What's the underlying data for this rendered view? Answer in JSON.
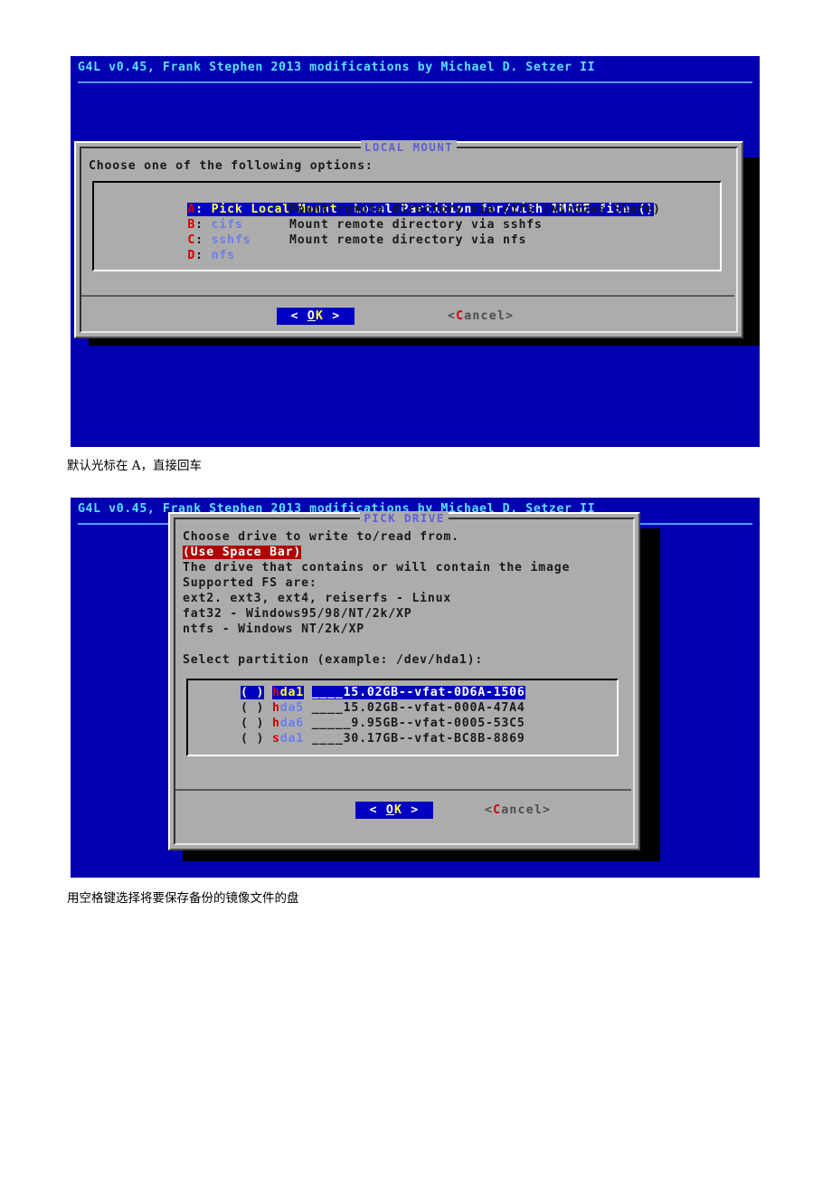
{
  "document": {
    "captions": [
      {
        "id": "caption-1",
        "text": "默认光标在 A，直接回车"
      },
      {
        "id": "caption-2",
        "text": "用空格键选择将要保存备份的镜像文件的盘"
      }
    ]
  },
  "colors": {
    "terminal_background": "#0000b0",
    "header_text": "#5ce0ff",
    "header_rule": "#5599ff",
    "dialog_background": "#acacac",
    "dialog_title": "#5f5fd7",
    "selection_background": "#0000c0",
    "selection_text": "#ffff40",
    "key_letter": "#d00000",
    "option_name": "#6a7fe8",
    "warning_background": "#b00000",
    "shadow": "#000000"
  },
  "screen_1": {
    "header": "G4L v0.45, Frank Stephen 2013 modifications by Michael D. Setzer II",
    "dialog": {
      "title": "LOCAL MOUNT",
      "prompt": "Choose one of the following options:",
      "options": [
        {
          "key": "A",
          "name": "Pick Local Mount",
          "desc": "Local Partition for/with IMAGE file ()",
          "selected": true
        },
        {
          "key": "B",
          "name": "cifs",
          "desc": "Mount remote directory via cifs (Windows Share)",
          "selected": false
        },
        {
          "key": "C",
          "name": "sshfs",
          "desc": "Mount remote directory via sshfs",
          "selected": false
        },
        {
          "key": "D",
          "name": "nfs",
          "desc": "Mount remote directory via nfs",
          "selected": false
        }
      ],
      "buttons": {
        "ok_left": "<",
        "ok_accel_underlined": "O",
        "ok_accel": "K",
        "ok_right": ">",
        "ok_label": "OK",
        "cancel_open": "<",
        "cancel_accel": "C",
        "cancel_rest": "ancel",
        "cancel_close": ">",
        "cancel_label": "Cancel"
      }
    }
  },
  "screen_2": {
    "header": "G4L v0.45, Frank Stephen 2013 modifications by Michael D. Setzer II",
    "dialog": {
      "title": "PICK DRIVE",
      "lines": [
        {
          "text": "Choose drive to write to/read from.",
          "highlight": false
        },
        {
          "text": "(Use Space Bar)",
          "highlight": true
        },
        {
          "text": "The drive that contains or will contain the image",
          "highlight": false
        },
        {
          "text": "Supported FS are:",
          "highlight": false
        },
        {
          "text": "ext2. ext3, ext4, reiserfs - Linux",
          "highlight": false
        },
        {
          "text": "fat32 - Windows95/98/NT/2k/XP",
          "highlight": false
        },
        {
          "text": "ntfs - Windows NT/2k/XP",
          "highlight": false
        },
        {
          "text": "",
          "highlight": false
        },
        {
          "text": "Select partition (example: /dev/hda1):",
          "highlight": false
        }
      ],
      "partitions": [
        {
          "checkbox": "( )",
          "first": "h",
          "rest": "da1",
          "info": "____15.02GB--vfat-0D6A-1506",
          "selected": true
        },
        {
          "checkbox": "( )",
          "first": "h",
          "rest": "da5",
          "info": "____15.02GB--vfat-000A-47A4",
          "selected": false
        },
        {
          "checkbox": "( )",
          "first": "h",
          "rest": "da6",
          "info": "_____9.95GB--vfat-0005-53C5",
          "selected": false
        },
        {
          "checkbox": "( )",
          "first": "s",
          "rest": "da1",
          "info": "____30.17GB--vfat-BC8B-8869",
          "selected": false
        }
      ],
      "buttons": {
        "ok_left": "<",
        "ok_accel_underlined": "O",
        "ok_accel": "K",
        "ok_right": ">",
        "ok_label": "OK",
        "cancel_open": "<",
        "cancel_accel": "C",
        "cancel_rest": "ancel",
        "cancel_close": ">",
        "cancel_label": "Cancel"
      }
    }
  }
}
